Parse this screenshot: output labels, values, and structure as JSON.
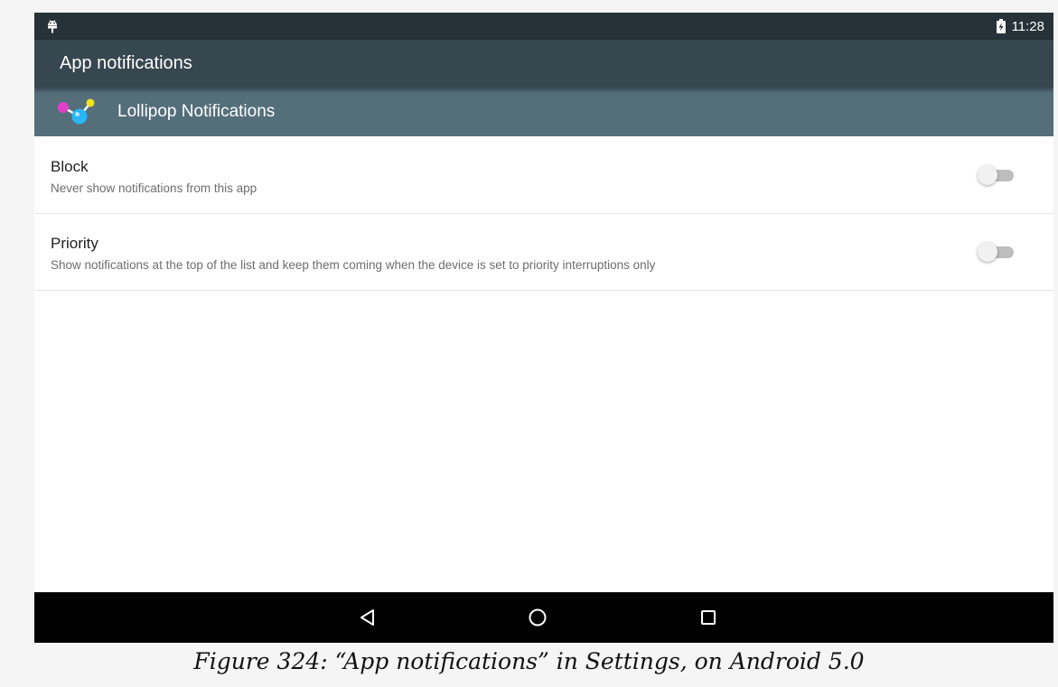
{
  "status_bar": {
    "time": "11:28",
    "left_icon": "android-debug-icon",
    "battery_icon": "battery-charging-icon"
  },
  "app_bar": {
    "title": "App notifications"
  },
  "app_header": {
    "app_name": "Lollipop Notifications",
    "icon": "molecule-app-icon"
  },
  "preferences": [
    {
      "title": "Block",
      "summary": "Never show notifications from this app",
      "enabled": false
    },
    {
      "title": "Priority",
      "summary": "Show notifications at the top of the list and keep them coming when the device is set to priority interruptions only",
      "enabled": false
    }
  ],
  "nav_bar": {
    "back_icon": "back-triangle-icon",
    "home_icon": "home-circle-icon",
    "recents_icon": "recents-square-icon"
  },
  "caption": "Figure 324: “App notifications” in Settings, on Android 5.0",
  "colors": {
    "status_bar": "#263238",
    "app_bar": "#37474f",
    "app_header": "#546e7a",
    "nav_bar": "#000000"
  }
}
